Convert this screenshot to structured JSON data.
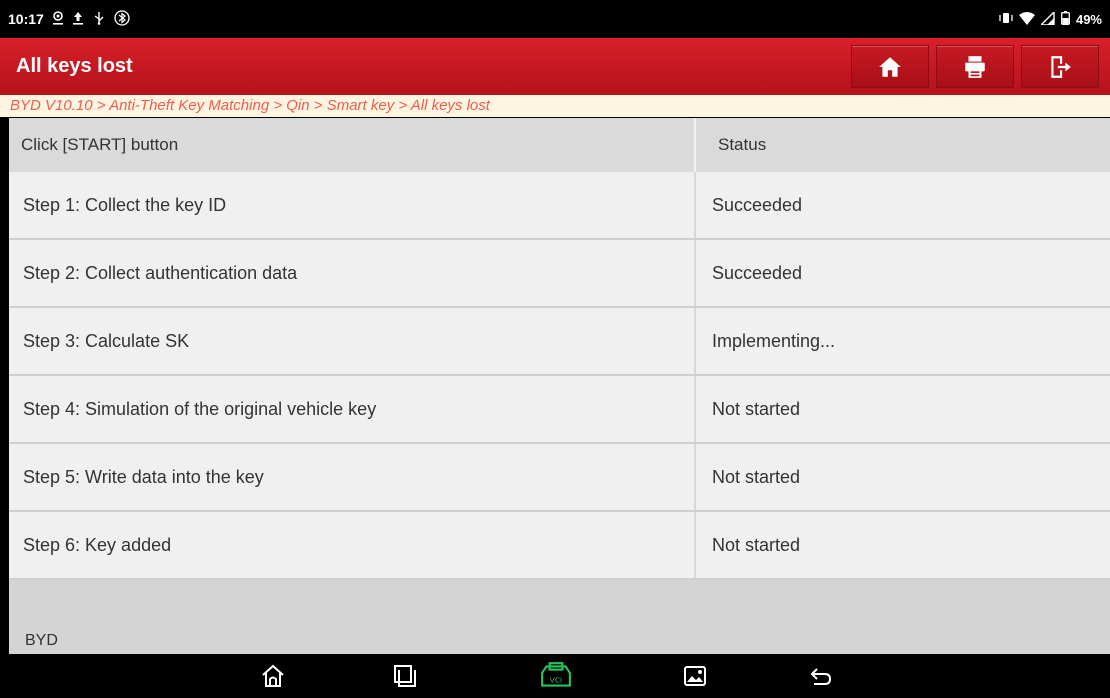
{
  "status_bar": {
    "time": "10:17",
    "battery": "49%",
    "left_icons": [
      "location-icon",
      "upload-icon",
      "usb-icon",
      "bluetooth-icon"
    ],
    "right_icons": [
      "vibrate-icon",
      "wifi-icon",
      "signal-icon",
      "battery-icon"
    ]
  },
  "header": {
    "title": "All keys lost",
    "buttons": [
      "home-icon",
      "print-icon",
      "exit-icon"
    ]
  },
  "breadcrumb": "BYD V10.10 > Anti-Theft Key Matching > Qin > Smart key > All keys lost",
  "table": {
    "header": {
      "col1": "Click [START] button",
      "col2": "Status"
    },
    "rows": [
      {
        "step": "Step 1: Collect the key ID",
        "status": "Succeeded"
      },
      {
        "step": "Step 2: Collect authentication data",
        "status": "Succeeded"
      },
      {
        "step": "Step 3: Calculate SK",
        "status": "Implementing..."
      },
      {
        "step": "Step 4: Simulation of the original vehicle key",
        "status": "Not started"
      },
      {
        "step": "Step 5: Write data into the key",
        "status": "Not started"
      },
      {
        "step": "Step 6: Key added",
        "status": "Not started"
      }
    ]
  },
  "footer": {
    "brand": "BYD"
  },
  "nav_bar": {
    "icons": [
      "home-outline-icon",
      "recents-icon",
      "vci-icon",
      "gallery-icon",
      "back-icon"
    ],
    "vci_label": "VCI"
  },
  "colors": {
    "header_red": "#c8161e",
    "breadcrumb_text": "#ef5d4d",
    "vci_green": "#22c55e"
  }
}
